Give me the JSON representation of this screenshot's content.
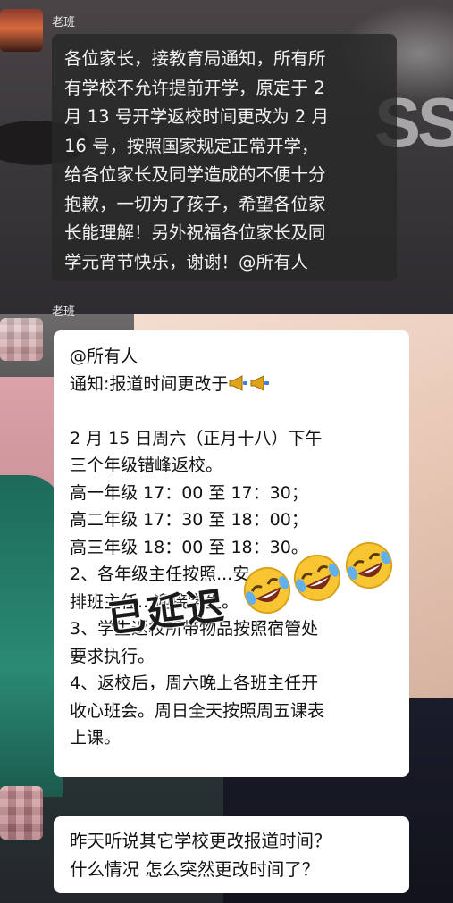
{
  "messages": [
    {
      "sender": "老班",
      "lines": [
        "各位家长，接教育局通知，所有所",
        "有学校不允许提前开学，原定于 2",
        "月 13 号开学返校时间更改为 2 月",
        "16 号，按照国家规定正常开学，",
        "给各位家长及同学造成的不便十分",
        "抱歉，一切为了孩子，希望各位家",
        "长能理解！另外祝福各位家长及同",
        "学元宵节快乐，谢谢！@所有人"
      ]
    },
    {
      "sender": "老班",
      "lines": [
        "@所有人",
        "通知:报道时间更改于",
        "",
        "2 月 15 日周六（正月十八）下午",
        "三个年级错峰返校。",
        "高一年级 17：00 至 17：30；",
        "高二年级 17：30 至 18：00；",
        "高三年级 18：00 至 18：30。",
        "2、各年级主任按照...安",
        "排班主任...迎接学生。",
        "3、学生返校所带物品按照宿管处",
        "要求执行。",
        "4、返校后，周六晚上各班主任开",
        "收心班会。周日全天按照周五课表",
        "上课。"
      ],
      "icons": [
        "megaphone-icon",
        "megaphone-icon"
      ]
    },
    {
      "sender": "",
      "lines": [
        "昨天听说其它学校更改报道时间？",
        "什么情况 怎么突然更改时间了？"
      ]
    }
  ],
  "stamp": "已延迟",
  "stickers": [
    "rofl-emoji",
    "rofl-emoji",
    "rofl-emoji"
  ],
  "background": {
    "overlay_text": "SS"
  },
  "colors": {
    "bubble_dark": "#282828",
    "bubble_white": "#ffffff",
    "stamp": "#1a1a1a"
  }
}
